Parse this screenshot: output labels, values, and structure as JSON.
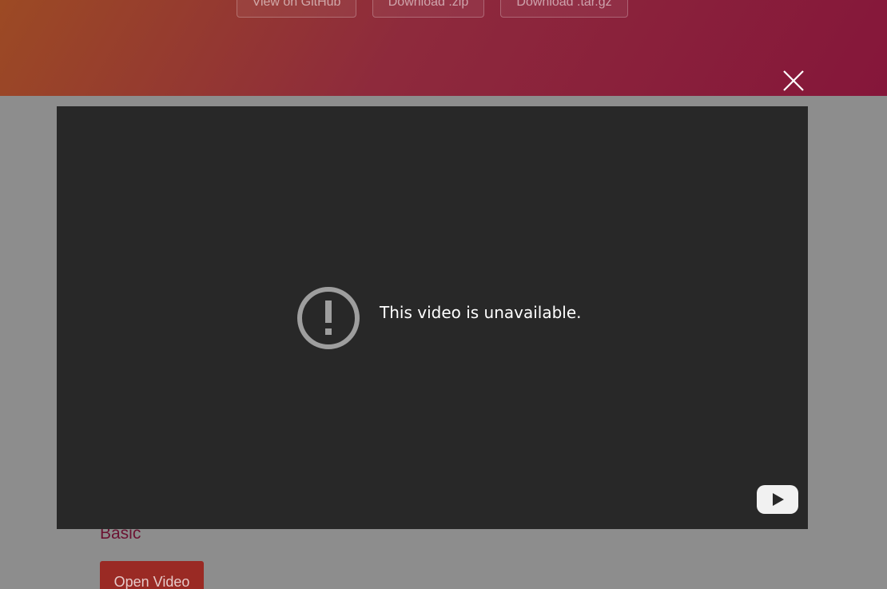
{
  "header": {
    "buttons": [
      {
        "label": "View on GitHub"
      },
      {
        "label": "Download .zip"
      },
      {
        "label": "Download .tar.gz"
      }
    ]
  },
  "content": {
    "section_title": "Basic",
    "open_video_label": "Open Video"
  },
  "lightbox": {
    "close_icon": "close-icon",
    "video": {
      "message": "This video is unavailable.",
      "status_icon": "alert-circle-icon",
      "brand_icon": "youtube-play-icon"
    }
  },
  "colors": {
    "header_gradient_start": "#9c4a24",
    "header_gradient_end": "#85163a",
    "video_background": "#282828",
    "accent": "#6b1232"
  }
}
